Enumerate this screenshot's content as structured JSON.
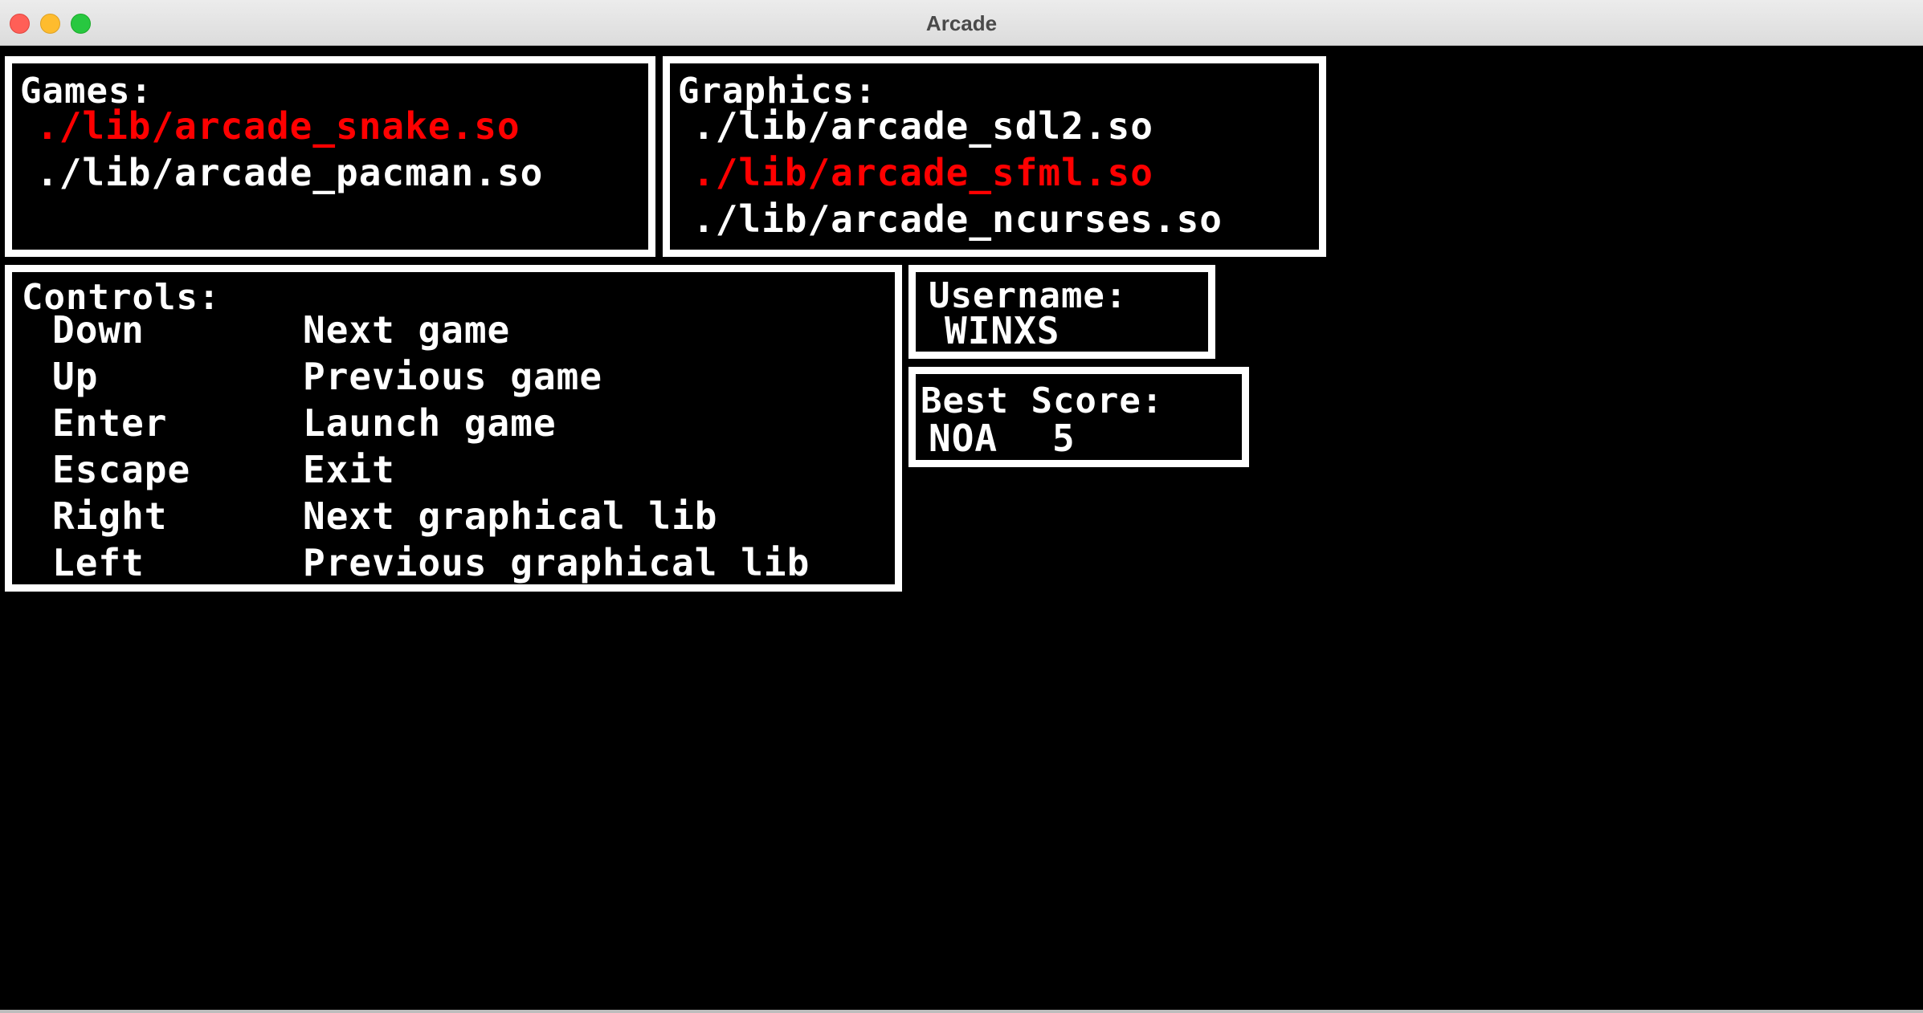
{
  "window": {
    "title": "Arcade"
  },
  "games": {
    "heading": "Games:",
    "items": [
      {
        "label": "./lib/arcade_snake.so",
        "selected": true
      },
      {
        "label": "./lib/arcade_pacman.so",
        "selected": false
      }
    ]
  },
  "graphics": {
    "heading": "Graphics:",
    "items": [
      {
        "label": "./lib/arcade_sdl2.so",
        "selected": false
      },
      {
        "label": "./lib/arcade_sfml.so",
        "selected": true
      },
      {
        "label": "./lib/arcade_ncurses.so",
        "selected": false
      }
    ]
  },
  "controls": {
    "heading": "Controls:",
    "rows": [
      {
        "key": "Down",
        "action": "Next game"
      },
      {
        "key": "Up",
        "action": "Previous game"
      },
      {
        "key": "Enter",
        "action": "Launch game"
      },
      {
        "key": "Escape",
        "action": "Exit"
      },
      {
        "key": "Right",
        "action": "Next graphical lib"
      },
      {
        "key": "Left",
        "action": "Previous graphical lib"
      }
    ]
  },
  "username": {
    "heading": "Username:",
    "value": "WINXS"
  },
  "best_score": {
    "heading": "Best Score:",
    "player": "NOA",
    "score": "5"
  },
  "colors": {
    "background": "#000000",
    "text": "#ffffff",
    "selected": "#ff0000",
    "border": "#ffffff"
  }
}
